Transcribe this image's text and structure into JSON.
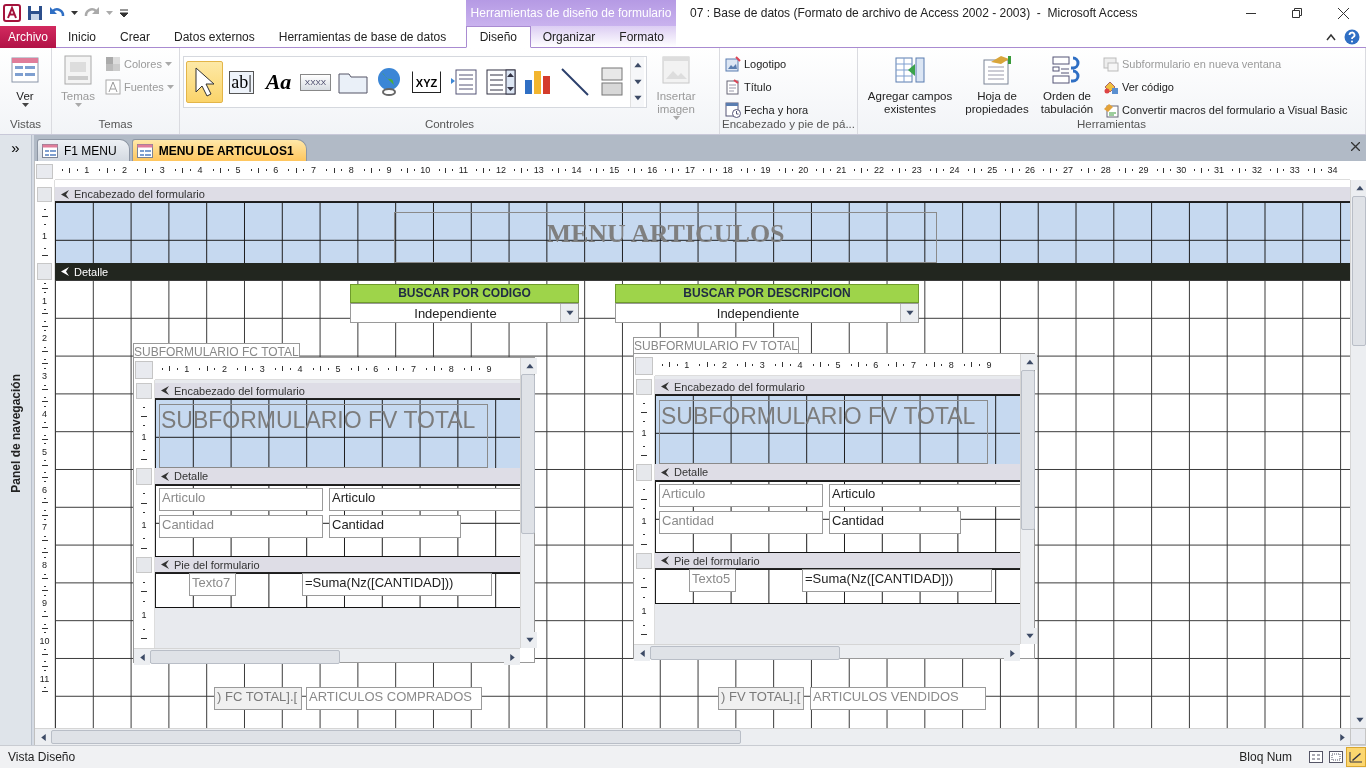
{
  "window": {
    "title": "07 : Base de datos (Formato de archivo de Access 2002 - 2003)  -  Microsoft Access",
    "context_group": "Herramientas de diseño de formulario"
  },
  "ribbon_tabs": [
    {
      "label": "Archivo",
      "kind": "file",
      "selected": false
    },
    {
      "label": "Inicio",
      "kind": "tab",
      "selected": false
    },
    {
      "label": "Crear",
      "kind": "tab",
      "selected": false
    },
    {
      "label": "Datos externos",
      "kind": "tab",
      "selected": false
    },
    {
      "label": "Herramientas de base de datos",
      "kind": "tab",
      "selected": false
    },
    {
      "label": "Diseño",
      "kind": "context",
      "selected": true
    },
    {
      "label": "Organizar",
      "kind": "context",
      "selected": false
    },
    {
      "label": "Formato",
      "kind": "context",
      "selected": false
    }
  ],
  "ribbon_groups": [
    {
      "kind": "views",
      "label": "Vistas",
      "items": [
        {
          "kind": "large",
          "label": "Ver",
          "disabled": false,
          "dropdown": true
        }
      ]
    },
    {
      "kind": "themes",
      "label": "Temas",
      "items": [
        {
          "kind": "large",
          "label": "Temas",
          "disabled": true,
          "dropdown": true
        },
        {
          "kind": "small",
          "label": "Colores",
          "disabled": true,
          "dropdown": true
        },
        {
          "kind": "small",
          "label": "Fuentes",
          "disabled": true,
          "dropdown": true
        }
      ]
    },
    {
      "kind": "controls",
      "label": "Controles",
      "tools": [
        {
          "kind": "pointer",
          "selected": true
        },
        {
          "kind": "textbox",
          "glyph": "ab|",
          "selected": false
        },
        {
          "kind": "label",
          "glyph": "Aa",
          "selected": false
        },
        {
          "kind": "button",
          "glyph": "XXXX",
          "selected": false
        },
        {
          "kind": "tab",
          "selected": false
        },
        {
          "kind": "hyperlink",
          "selected": false
        },
        {
          "kind": "frame",
          "glyph": "XYZ",
          "selected": false
        },
        {
          "kind": "listbox",
          "selected": false
        },
        {
          "kind": "combobox",
          "selected": false
        },
        {
          "kind": "chart",
          "selected": false
        },
        {
          "kind": "line",
          "selected": false
        },
        {
          "kind": "toggle",
          "selected": false
        }
      ],
      "items": [
        {
          "kind": "large",
          "label": "Insertar imagen",
          "disabled": true,
          "dropdown": true
        }
      ]
    },
    {
      "kind": "header_footer",
      "label": "Encabezado y pie de pá...",
      "items": [
        {
          "kind": "small",
          "label": "Logotipo",
          "disabled": false,
          "dropdown": false
        },
        {
          "kind": "small",
          "label": "Título",
          "disabled": false,
          "dropdown": false
        },
        {
          "kind": "small",
          "label": "Fecha y hora",
          "disabled": false,
          "dropdown": false
        }
      ]
    },
    {
      "kind": "tools",
      "label": "Herramientas",
      "items": [
        {
          "kind": "large",
          "label": "Agregar campos existentes",
          "disabled": false,
          "dropdown": false
        },
        {
          "kind": "large",
          "label": "Hoja de propiedades",
          "disabled": false,
          "dropdown": false
        },
        {
          "kind": "large",
          "label": "Orden de tabulación",
          "disabled": false,
          "dropdown": false
        },
        {
          "kind": "small",
          "label": "Subformulario en nueva ventana",
          "disabled": true,
          "dropdown": false
        },
        {
          "kind": "small",
          "label": "Ver código",
          "disabled": false,
          "dropdown": false
        },
        {
          "kind": "small",
          "label": "Convertir macros del formulario a Visual Basic",
          "disabled": false,
          "dropdown": false
        }
      ]
    }
  ],
  "nav_pane": {
    "toggle": "»",
    "title": "Panel de navegación"
  },
  "document_tabs": [
    {
      "label": "F1 MENU",
      "selected": false
    },
    {
      "label": "MENU DE ARTICULOS1",
      "selected": true
    }
  ],
  "form": {
    "ruler": [
      "1",
      "2",
      "3",
      "4",
      "5",
      "6",
      "7",
      "8",
      "9",
      "10",
      "11",
      "12",
      "13",
      "14",
      "15",
      "16",
      "17",
      "18",
      "19",
      "20",
      "21",
      "22",
      "23",
      "24",
      "25",
      "26",
      "27",
      "28",
      "29",
      "30",
      "31",
      "32",
      "33",
      "34"
    ],
    "header": {
      "bar": "Encabezado del formulario",
      "ruler": [
        "1"
      ],
      "title": "MENU ARTICULOS"
    },
    "detail": {
      "bar": "Detalle",
      "ruler": [
        "1",
        "2",
        "3",
        "4",
        "5",
        "6",
        "7",
        "8",
        "9",
        "10",
        "11"
      ],
      "combos": [
        {
          "label": "BUSCAR POR CODIGO",
          "value": "Independiente"
        },
        {
          "label": "BUSCAR POR DESCRIPCION",
          "value": "Independiente"
        }
      ],
      "subforms": [
        {
          "caption": "SUBFORMULARIO FC TOTAL",
          "ruler": [
            "1",
            "2",
            "3",
            "4",
            "5",
            "6",
            "7",
            "8",
            "9"
          ],
          "header_bar": "Encabezado del formulario",
          "header_ruler": [
            "1"
          ],
          "title": "SUBFORMULARIO FV TOTAL",
          "detail_bar": "Detalle",
          "detail_ruler": [
            "1"
          ],
          "fields": [
            {
              "label": "Articulo",
              "value": "Articulo"
            },
            {
              "label": "Cantidad",
              "value": "Cantidad"
            }
          ],
          "footer_bar": "Pie del formulario",
          "footer_ruler": [
            "1"
          ],
          "footer_label": "Texto7",
          "footer_value": "=Suma(Nz([CANTIDAD]))"
        },
        {
          "caption": "SUBFORMULARIO FV TOTAL",
          "ruler": [
            "1",
            "2",
            "3",
            "4",
            "5",
            "6",
            "7",
            "8",
            "9"
          ],
          "header_bar": "Encabezado del formulario",
          "header_ruler": [
            "1"
          ],
          "title": "SUBFORMULARIO FV TOTAL",
          "detail_bar": "Detalle",
          "detail_ruler": [
            "1"
          ],
          "fields": [
            {
              "label": "Articulo",
              "value": "Articulo"
            },
            {
              "label": "Cantidad",
              "value": "Cantidad"
            }
          ],
          "footer_bar": "Pie del formulario",
          "footer_ruler": [
            "1"
          ],
          "footer_label": "Texto5",
          "footer_value": "=Suma(Nz([CANTIDAD]))"
        }
      ],
      "totals": [
        {
          "ref": ") FC TOTAL].[",
          "label": "ARTICULOS COMPRADOS"
        },
        {
          "ref": ") FV TOTAL].[",
          "label": "ARTICULOS VENDIDOS"
        }
      ]
    }
  },
  "status_bar": {
    "mode": "Vista Diseño",
    "indicator": "Bloq Num",
    "views": [
      {
        "kind": "form",
        "selected": false
      },
      {
        "kind": "layout",
        "selected": false
      },
      {
        "kind": "design",
        "selected": true
      }
    ]
  }
}
